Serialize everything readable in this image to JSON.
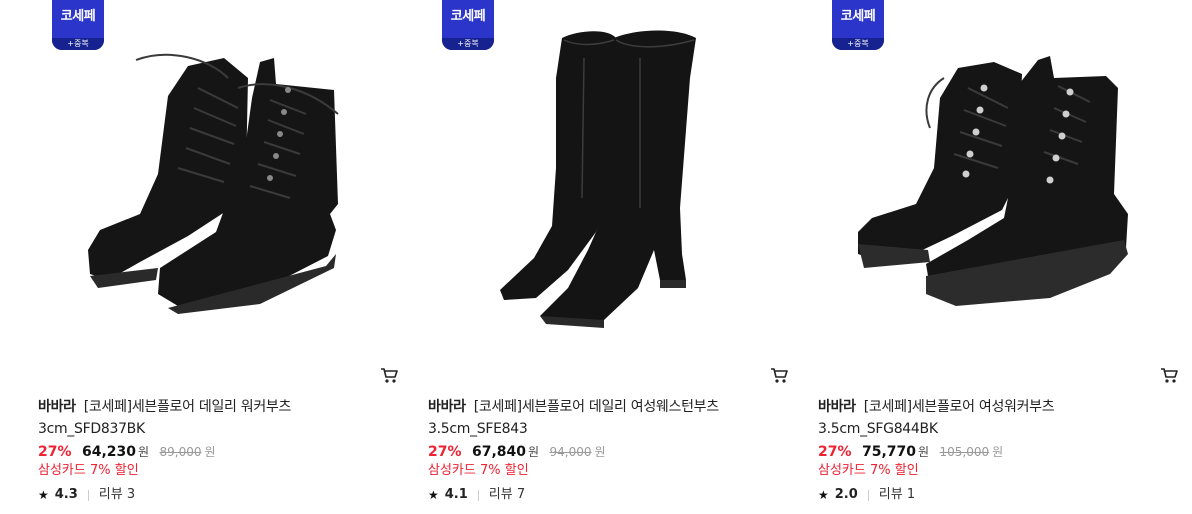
{
  "accent_colors": {
    "badge": "#2b35c9",
    "discount": "#ee2233"
  },
  "products": [
    {
      "badge": {
        "main": "코세페",
        "sub": "+중복"
      },
      "brand": "바바라",
      "name": "[코세페]세븐플로어 데일리 워커부츠",
      "model": "3cm_SFD837BK",
      "discount": "27%",
      "sale_price": "64,230",
      "currency": "원",
      "original_price": "89,000",
      "card_promo": "삼성카드 7% 할인",
      "rating": "4.3",
      "reviews": "리뷰 3",
      "image_icon": "lace-up-worker-boots",
      "cart_icon": "cart-icon"
    },
    {
      "badge": {
        "main": "코세페",
        "sub": "+중복"
      },
      "brand": "바바라",
      "name": "[코세페]세븐플로어 데일리 여성웨스턴부츠",
      "model": "3.5cm_SFE843",
      "discount": "27%",
      "sale_price": "67,840",
      "currency": "원",
      "original_price": "94,000",
      "card_promo": "삼성카드 7% 할인",
      "rating": "4.1",
      "reviews": "리뷰 7",
      "image_icon": "knee-high-western-boots",
      "cart_icon": "cart-icon"
    },
    {
      "badge": {
        "main": "코세페",
        "sub": "+중복"
      },
      "brand": "바바라",
      "name": "[코세페]세븐플로어 여성워커부츠",
      "model": "3.5cm_SFG844BK",
      "discount": "27%",
      "sale_price": "75,770",
      "currency": "원",
      "original_price": "105,000",
      "card_promo": "삼성카드 7% 할인",
      "rating": "2.0",
      "reviews": "리뷰 1",
      "image_icon": "chunky-lace-up-worker-boots",
      "cart_icon": "cart-icon"
    }
  ]
}
